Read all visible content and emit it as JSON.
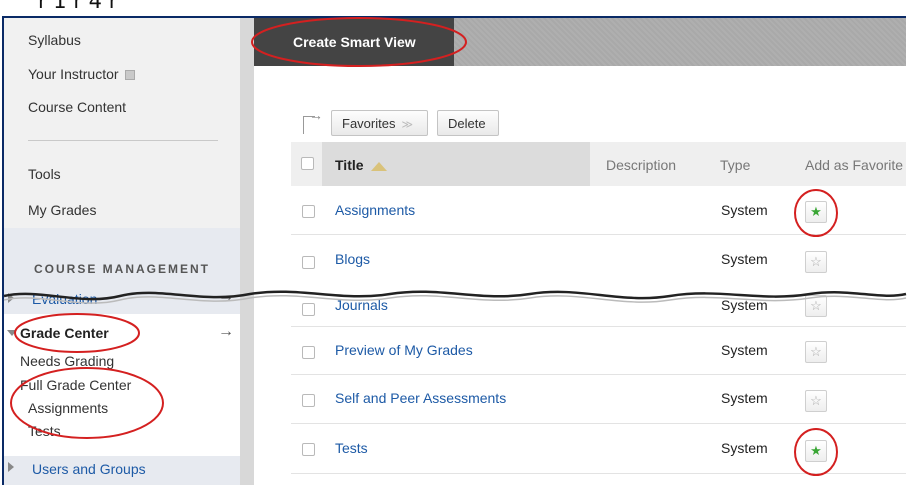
{
  "sidebar": {
    "items": [
      {
        "label": "Syllabus"
      },
      {
        "label": "Your Instructor"
      },
      {
        "label": "Course Content"
      },
      {
        "label": "Tools"
      },
      {
        "label": "My Grades"
      }
    ],
    "management_title": "COURSE MANAGEMENT",
    "evaluation": "Evaluation",
    "grade_center": "Grade Center",
    "needs_grading": "Needs Grading",
    "full_grade_center": "Full Grade Center",
    "assignments": "Assignments",
    "tests": "Tests",
    "users_and_groups": "Users and Groups"
  },
  "header": {
    "create_smart_view": "Create Smart View"
  },
  "toolbar": {
    "favorites_label": "Favorites",
    "delete_label": "Delete"
  },
  "table": {
    "columns": [
      "Title",
      "Description",
      "Type",
      "Add as Favorite"
    ],
    "rows": [
      {
        "title": "Assignments",
        "type": "System",
        "favorite": true
      },
      {
        "title": "Blogs",
        "type": "System",
        "favorite": false
      },
      {
        "title": "Journals",
        "type": "System",
        "favorite": false
      },
      {
        "title": "Preview of My Grades",
        "type": "System",
        "favorite": false
      },
      {
        "title": "Self and Peer Assessments",
        "type": "System",
        "favorite": false
      },
      {
        "title": "Tests",
        "type": "System",
        "favorite": true
      }
    ]
  },
  "colors": {
    "annotation": "#d42020",
    "link": "#1d5aa6",
    "favorite_star": "#3aa635",
    "header_dark": "#444444"
  },
  "icons": {
    "favorite_on": "green-star-icon",
    "favorite_off": "gray-star-icon",
    "sort": "sort-ascending-icon"
  }
}
